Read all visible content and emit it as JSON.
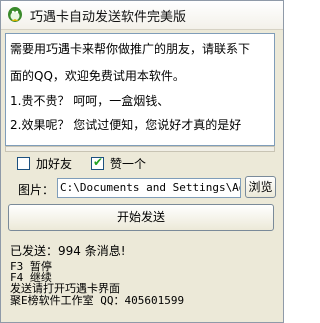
{
  "window": {
    "title": "巧遇卡自动发送软件完美版"
  },
  "message": {
    "lines": [
      "需要用巧遇卡来帮你做推广的朋友，请联系下",
      "面的QQ，欢迎免费试用本软件。",
      "1.贵不贵？   呵呵，一盒烟钱、",
      "2.效果呢？   您试过便知，您说好才真的是好"
    ]
  },
  "options": {
    "add_friend": {
      "label": "加好友",
      "checked": false
    },
    "like_one": {
      "label": "赞一个",
      "checked": true
    }
  },
  "picture": {
    "label": "图片：",
    "path": "C:\\Documents and Settings\\Administrator",
    "browse_label": "浏览"
  },
  "start_button": {
    "label": "开始发送"
  },
  "status": {
    "text": "已发送：994 条消息!"
  },
  "info_lines": [
    "F3 暂停",
    "F4 继续",
    "发送请打开巧遇卡界面",
    "聚E榜软件工作室 QQ：405601599"
  ],
  "colors": {
    "icon_green": "#3a8a2a",
    "check_green": "#21a121",
    "border_blue": "#7f9db9"
  }
}
